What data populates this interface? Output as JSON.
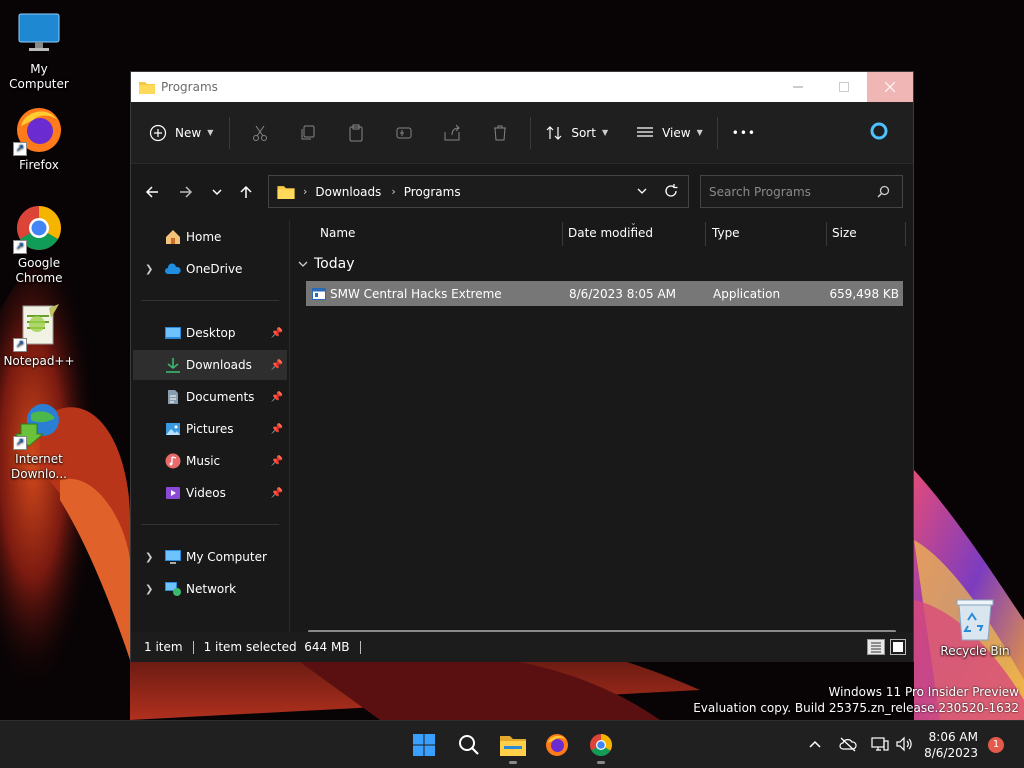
{
  "desktop": {
    "icons": [
      {
        "label": "My Computer"
      },
      {
        "label": "Firefox"
      },
      {
        "label": "Google Chrome"
      },
      {
        "label": "Notepad++"
      },
      {
        "label": "Internet Downlo..."
      },
      {
        "label": "Recycle Bin"
      }
    ]
  },
  "window": {
    "title": "Programs",
    "toolbar": {
      "new_label": "New",
      "sort_label": "Sort",
      "view_label": "View",
      "more_label": "•••"
    },
    "address": {
      "crumbs": [
        "Downloads",
        "Programs"
      ]
    },
    "search": {
      "placeholder": "Search Programs"
    },
    "sidebar": {
      "items": [
        {
          "label": "Home"
        },
        {
          "label": "OneDrive"
        },
        {
          "label": "Desktop"
        },
        {
          "label": "Downloads"
        },
        {
          "label": "Documents"
        },
        {
          "label": "Pictures"
        },
        {
          "label": "Music"
        },
        {
          "label": "Videos"
        },
        {
          "label": "My Computer"
        },
        {
          "label": "Network"
        }
      ]
    },
    "columns": [
      "Name",
      "Date modified",
      "Type",
      "Size"
    ],
    "group": {
      "label": "Today"
    },
    "files": [
      {
        "name": "SMW Central Hacks Extreme",
        "date_modified": "8/6/2023 8:05 AM",
        "type": "Application",
        "size": "659,498 KB"
      }
    ],
    "status": {
      "count": "1 item",
      "selected": "1 item selected  644 MB"
    }
  },
  "watermark": {
    "line1": "Windows 11 Pro Insider Preview",
    "line2": "Evaluation copy. Build 25375.zn_release.230520-1632"
  },
  "taskbar": {
    "time": "8:06 AM",
    "date": "8/6/2023",
    "notification_count": "1"
  },
  "colors": {
    "selection": "#777777",
    "accent": "#4cc2ff",
    "window_bg": "#191919",
    "notification": "#e35a4a"
  }
}
